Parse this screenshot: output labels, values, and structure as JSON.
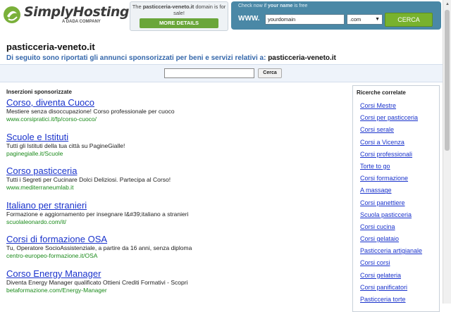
{
  "header": {
    "logo_text": "SimplyHosting",
    "logo_sub": "A DADA COMPANY",
    "forsale_prefix": "The ",
    "forsale_domain": "pasticceria-veneto.it",
    "forsale_suffix": " domain is for sale!",
    "more_details_label": "MORE DETAILS",
    "check_prefix": "Check now if ",
    "check_strong": "your name",
    "check_suffix": " is free",
    "www_label": "WWW.",
    "domain_value": "yourdomain",
    "tld_value": ".com",
    "cerca_label": "CERCA"
  },
  "page": {
    "title": "pasticceria-veneto.it",
    "intro_text": "Di seguito sono riportati gli annunci sponsorizzati per beni e servizi relativi a: ",
    "intro_domain": "pasticceria-veneto.it",
    "search_button": "Cerca"
  },
  "ads": {
    "heading": "Inserzioni sponsorizzate",
    "items": [
      {
        "title": "Corso, diventa Cuoco",
        "desc": "Mestiere senza disoccupazione! Corso professionale per cuoco",
        "url": "www.corsipratici.it/fp/corso-cuoco/"
      },
      {
        "title": "Scuole e Istituti",
        "desc": "Tutti gli Istituti della tua città su PagineGialle!",
        "url": "paginegialle.it/Scuole"
      },
      {
        "title": "Corso pasticceria",
        "desc": "Tutti i Segreti per Cucinare Dolci Deliziosi. Partecipa al Corso!",
        "url": "www.mediterraneumlab.it"
      },
      {
        "title": "Italiano per stranieri",
        "desc": "Formazione e aggiornamento per insegnare l&#39;italiano a stranieri",
        "url": "scuolaleonardo.com/it/"
      },
      {
        "title": "Corsi di formazione OSA",
        "desc": "Tu, Operatore SocioAssistenziale, a partire da 16 anni, senza diploma",
        "url": "centro-europeo-formazione.it/OSA"
      },
      {
        "title": "Corso Energy Manager",
        "desc": "Diventa Energy Manager qualificato Ottieni Crediti Formativi - Scopri",
        "url": "betaformazione.com/Energy-Manager"
      }
    ]
  },
  "related": {
    "heading": "Ricerche correlate",
    "items": [
      "Corsi Mestre",
      "Corsi per pasticceria",
      "Corsi serale",
      "Corsi a Vicenza",
      "Corsi professionali",
      "Torte to go",
      "Corsi formazione",
      "A massage",
      "Corsi panettiere",
      "Scuola pasticceria",
      "Corsi cucina",
      "Corsi gelataio",
      "Pasticceria artigianale",
      "Corsi corsi",
      "Corsi gelateria",
      "Corsi panificatori",
      "Pasticceria torte"
    ]
  },
  "colors": {
    "link_blue": "#1a33cc",
    "url_green": "#1a8a1a",
    "intro_blue": "#3366aa",
    "brand_green": "#6aa63a",
    "search_panel_blue": "#4a88a6"
  }
}
